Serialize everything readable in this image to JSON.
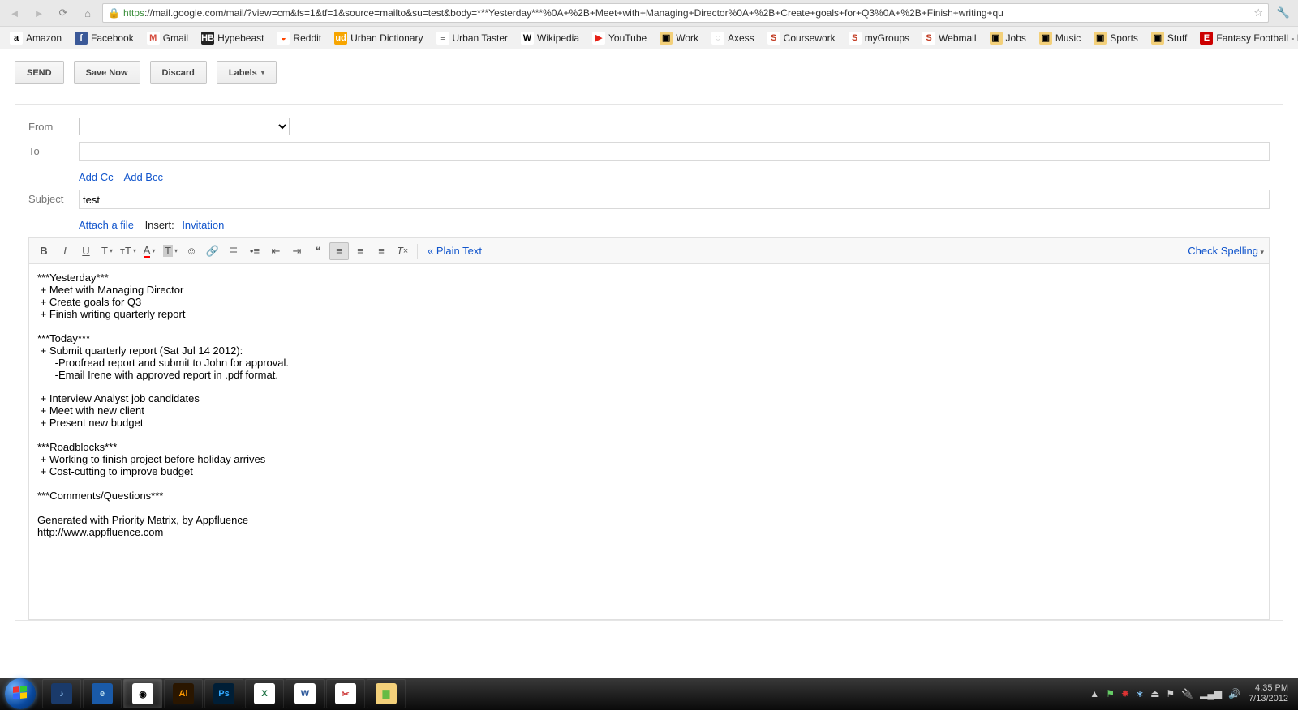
{
  "browser": {
    "url_https": "https",
    "url_rest": "://mail.google.com/mail/?view=cm&fs=1&tf=1&source=mailto&su=test&body=***Yesterday***%0A+%2B+Meet+with+Managing+Director%0A+%2B+Create+goals+for+Q3%0A+%2B+Finish+writing+qu"
  },
  "bookmarks": [
    {
      "label": "Amazon",
      "bg": "#fff",
      "fg": "#000",
      "ch": "a"
    },
    {
      "label": "Facebook",
      "bg": "#3b5998",
      "fg": "#fff",
      "ch": "f"
    },
    {
      "label": "Gmail",
      "bg": "#fff",
      "fg": "#d54b3d",
      "ch": "M"
    },
    {
      "label": "Hypebeast",
      "bg": "#222",
      "fg": "#fff",
      "ch": "HB"
    },
    {
      "label": "Reddit",
      "bg": "#fff",
      "fg": "#ff4500",
      "ch": "◒"
    },
    {
      "label": "Urban Dictionary",
      "bg": "#f7a500",
      "fg": "#fff",
      "ch": "ud"
    },
    {
      "label": "Urban Taster",
      "bg": "#fff",
      "fg": "#555",
      "ch": "≡"
    },
    {
      "label": "Wikipedia",
      "bg": "#fff",
      "fg": "#000",
      "ch": "W"
    },
    {
      "label": "YouTube",
      "bg": "#fff",
      "fg": "#e62117",
      "ch": "▶"
    },
    {
      "label": "Work",
      "bg": "#f3d07a",
      "fg": "#000",
      "ch": ""
    },
    {
      "label": "Axess",
      "bg": "#fff",
      "fg": "#888",
      "ch": "◌"
    },
    {
      "label": "Coursework",
      "bg": "#fff",
      "fg": "#c23b22",
      "ch": "S"
    },
    {
      "label": "myGroups",
      "bg": "#fff",
      "fg": "#c23b22",
      "ch": "S"
    },
    {
      "label": "Webmail",
      "bg": "#fff",
      "fg": "#c23b22",
      "ch": "S"
    },
    {
      "label": "Jobs",
      "bg": "#f3d07a",
      "fg": "#000",
      "ch": ""
    },
    {
      "label": "Music",
      "bg": "#f3d07a",
      "fg": "#000",
      "ch": ""
    },
    {
      "label": "Sports",
      "bg": "#f3d07a",
      "fg": "#000",
      "ch": ""
    },
    {
      "label": "Stuff",
      "bg": "#f3d07a",
      "fg": "#000",
      "ch": ""
    },
    {
      "label": "Fantasy Football - E...",
      "bg": "#c00",
      "fg": "#fff",
      "ch": "E"
    }
  ],
  "actions": {
    "send": "SEND",
    "save": "Save Now",
    "discard": "Discard",
    "labels": "Labels"
  },
  "fields": {
    "from": "From",
    "to": "To",
    "subject": "Subject",
    "addcc": "Add Cc",
    "addbcc": "Add Bcc",
    "attach": "Attach a file",
    "insert": "Insert:",
    "invitation": "Invitation"
  },
  "subject_value": "test",
  "toolbar": {
    "plain": "« Plain Text",
    "spell": "Check Spelling"
  },
  "body": "***Yesterday***\n + Meet with Managing Director\n + Create goals for Q3\n + Finish writing quarterly report\n\n***Today***\n + Submit quarterly report (Sat Jul 14 2012):\n      -Proofread report and submit to John for approval.\n      -Email Irene with approved report in .pdf format.\n\n + Interview Analyst job candidates\n + Meet with new client\n + Present new budget\n\n***Roadblocks***\n + Working to finish project before holiday arrives\n + Cost-cutting to improve budget\n\n***Comments/Questions***\n\nGenerated with Priority Matrix, by Appfluence\nhttp://www.appfluence.com",
  "taskbar": {
    "apps": [
      {
        "name": "itunes",
        "bg": "#1a3a6a",
        "fg": "#9cf",
        "ch": "♪"
      },
      {
        "name": "ie",
        "bg": "#1a5aa8",
        "fg": "#bde",
        "ch": "e"
      },
      {
        "name": "chrome",
        "bg": "#fff",
        "fg": "#000",
        "ch": "◉",
        "running": true
      },
      {
        "name": "illustrator",
        "bg": "#2a1600",
        "fg": "#ff9a00",
        "ch": "Ai"
      },
      {
        "name": "photoshop",
        "bg": "#001e36",
        "fg": "#31a8ff",
        "ch": "Ps"
      },
      {
        "name": "excel",
        "bg": "#fff",
        "fg": "#217346",
        "ch": "X"
      },
      {
        "name": "word",
        "bg": "#fff",
        "fg": "#2b579a",
        "ch": "W"
      },
      {
        "name": "snip",
        "bg": "#fff",
        "fg": "#c33",
        "ch": "✂"
      },
      {
        "name": "explorer",
        "bg": "#f3d07a",
        "fg": "#6b4",
        "ch": "▇"
      }
    ],
    "time": "4:35 PM",
    "date": "7/13/2012"
  }
}
